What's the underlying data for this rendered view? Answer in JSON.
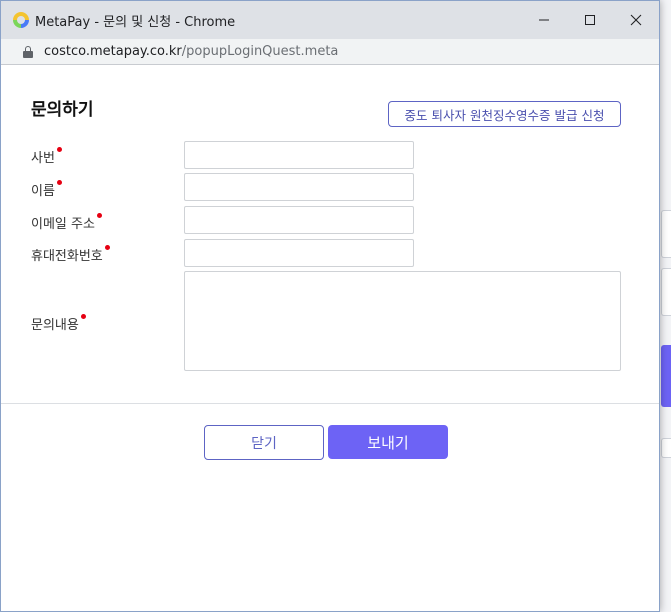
{
  "window": {
    "title": "MetaPay - 문의 및 신청 - Chrome"
  },
  "address": {
    "host": "costco.metapay.co.kr",
    "path": "/popupLoginQuest.meta"
  },
  "form": {
    "title": "문의하기",
    "top_button": "중도 퇴사자 원천징수영수증 발급 신청",
    "fields": [
      {
        "label": "사번",
        "value": ""
      },
      {
        "label": "이름",
        "value": ""
      },
      {
        "label": "이메일 주소",
        "value": ""
      },
      {
        "label": "휴대전화번호",
        "value": ""
      },
      {
        "label": "문의내용",
        "value": ""
      }
    ],
    "close_label": "닫기",
    "send_label": "보내기"
  },
  "colors": {
    "accent": "#6d63f5",
    "required": "#e60012",
    "outline": "#5d64c4"
  }
}
